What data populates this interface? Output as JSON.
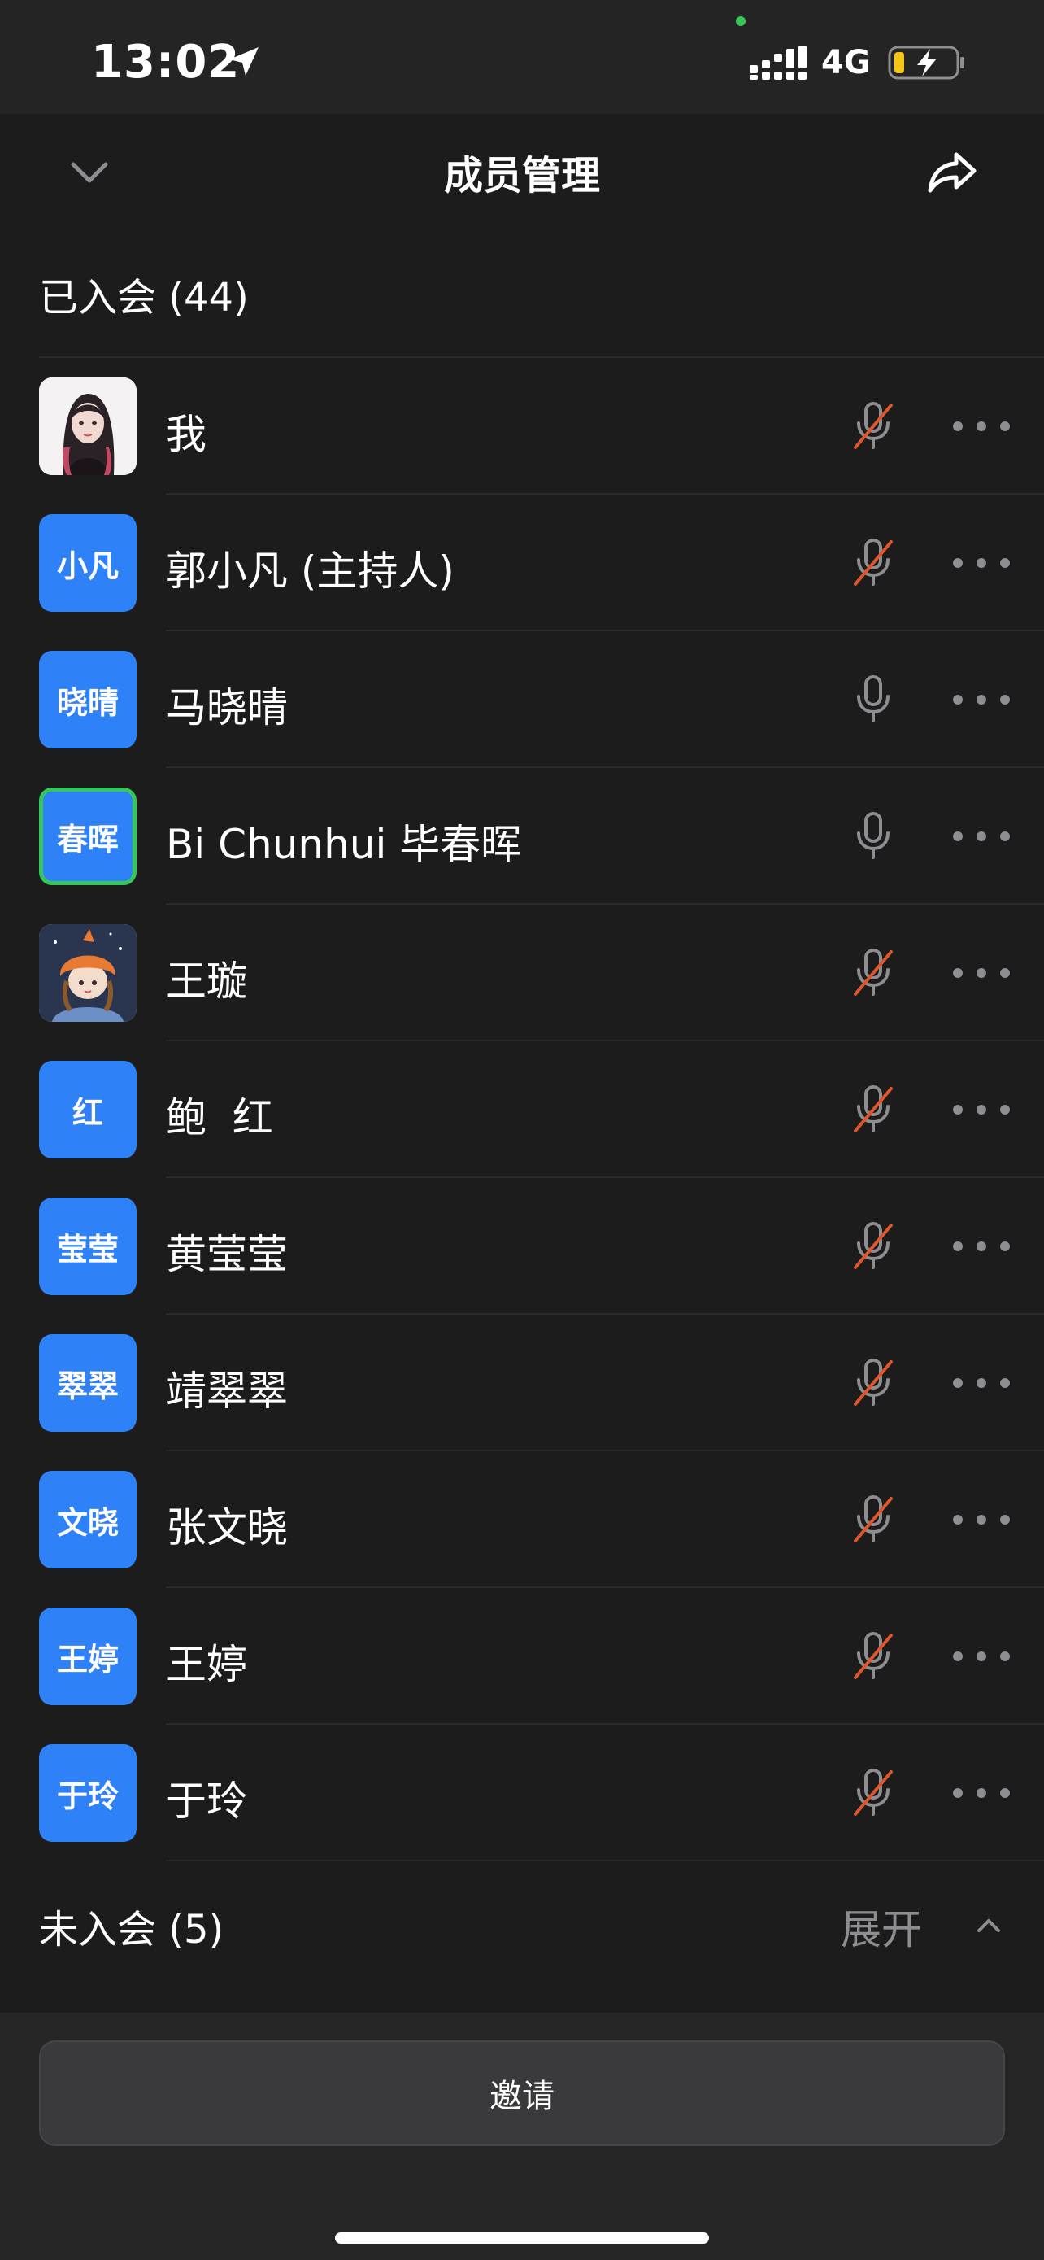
{
  "status_bar": {
    "time": "13:02",
    "network": "4G"
  },
  "nav": {
    "title": "成员管理"
  },
  "joined": {
    "label": "已入会 (44)"
  },
  "members": [
    {
      "name": "我",
      "avatar_text": "",
      "avatar_kind": "photo-girl",
      "mic": "muted"
    },
    {
      "name": "郭小凡 (主持人)",
      "avatar_text": "小凡",
      "avatar_kind": "initials",
      "mic": "muted"
    },
    {
      "name": "马晓晴",
      "avatar_text": "晓晴",
      "avatar_kind": "initials",
      "mic": "on"
    },
    {
      "name": "Bi Chunhui 毕春晖",
      "avatar_text": "春晖",
      "avatar_kind": "initials-active",
      "mic": "on"
    },
    {
      "name": "王璇",
      "avatar_text": "",
      "avatar_kind": "photo-hat",
      "mic": "muted"
    },
    {
      "name": "鲍  红",
      "avatar_text": "红",
      "avatar_kind": "initials",
      "mic": "muted"
    },
    {
      "name": "黄莹莹",
      "avatar_text": "莹莹",
      "avatar_kind": "initials",
      "mic": "muted"
    },
    {
      "name": "靖翠翠",
      "avatar_text": "翠翠",
      "avatar_kind": "initials",
      "mic": "muted"
    },
    {
      "name": "张文晓",
      "avatar_text": "文晓",
      "avatar_kind": "initials",
      "mic": "muted"
    },
    {
      "name": "王婷",
      "avatar_text": "王婷",
      "avatar_kind": "initials",
      "mic": "muted"
    },
    {
      "name": "于玲",
      "avatar_text": "于玲",
      "avatar_kind": "initials",
      "mic": "muted"
    }
  ],
  "pending": {
    "label": "未入会 (5)",
    "expand_label": "展开"
  },
  "footer": {
    "invite_label": "邀请"
  },
  "colors": {
    "background": "#1c1c1d",
    "avatar_blue": "#2f81f7",
    "muted_slash": "#e0572e",
    "mic_gray": "#8d8d92",
    "active_border": "#34c759"
  }
}
